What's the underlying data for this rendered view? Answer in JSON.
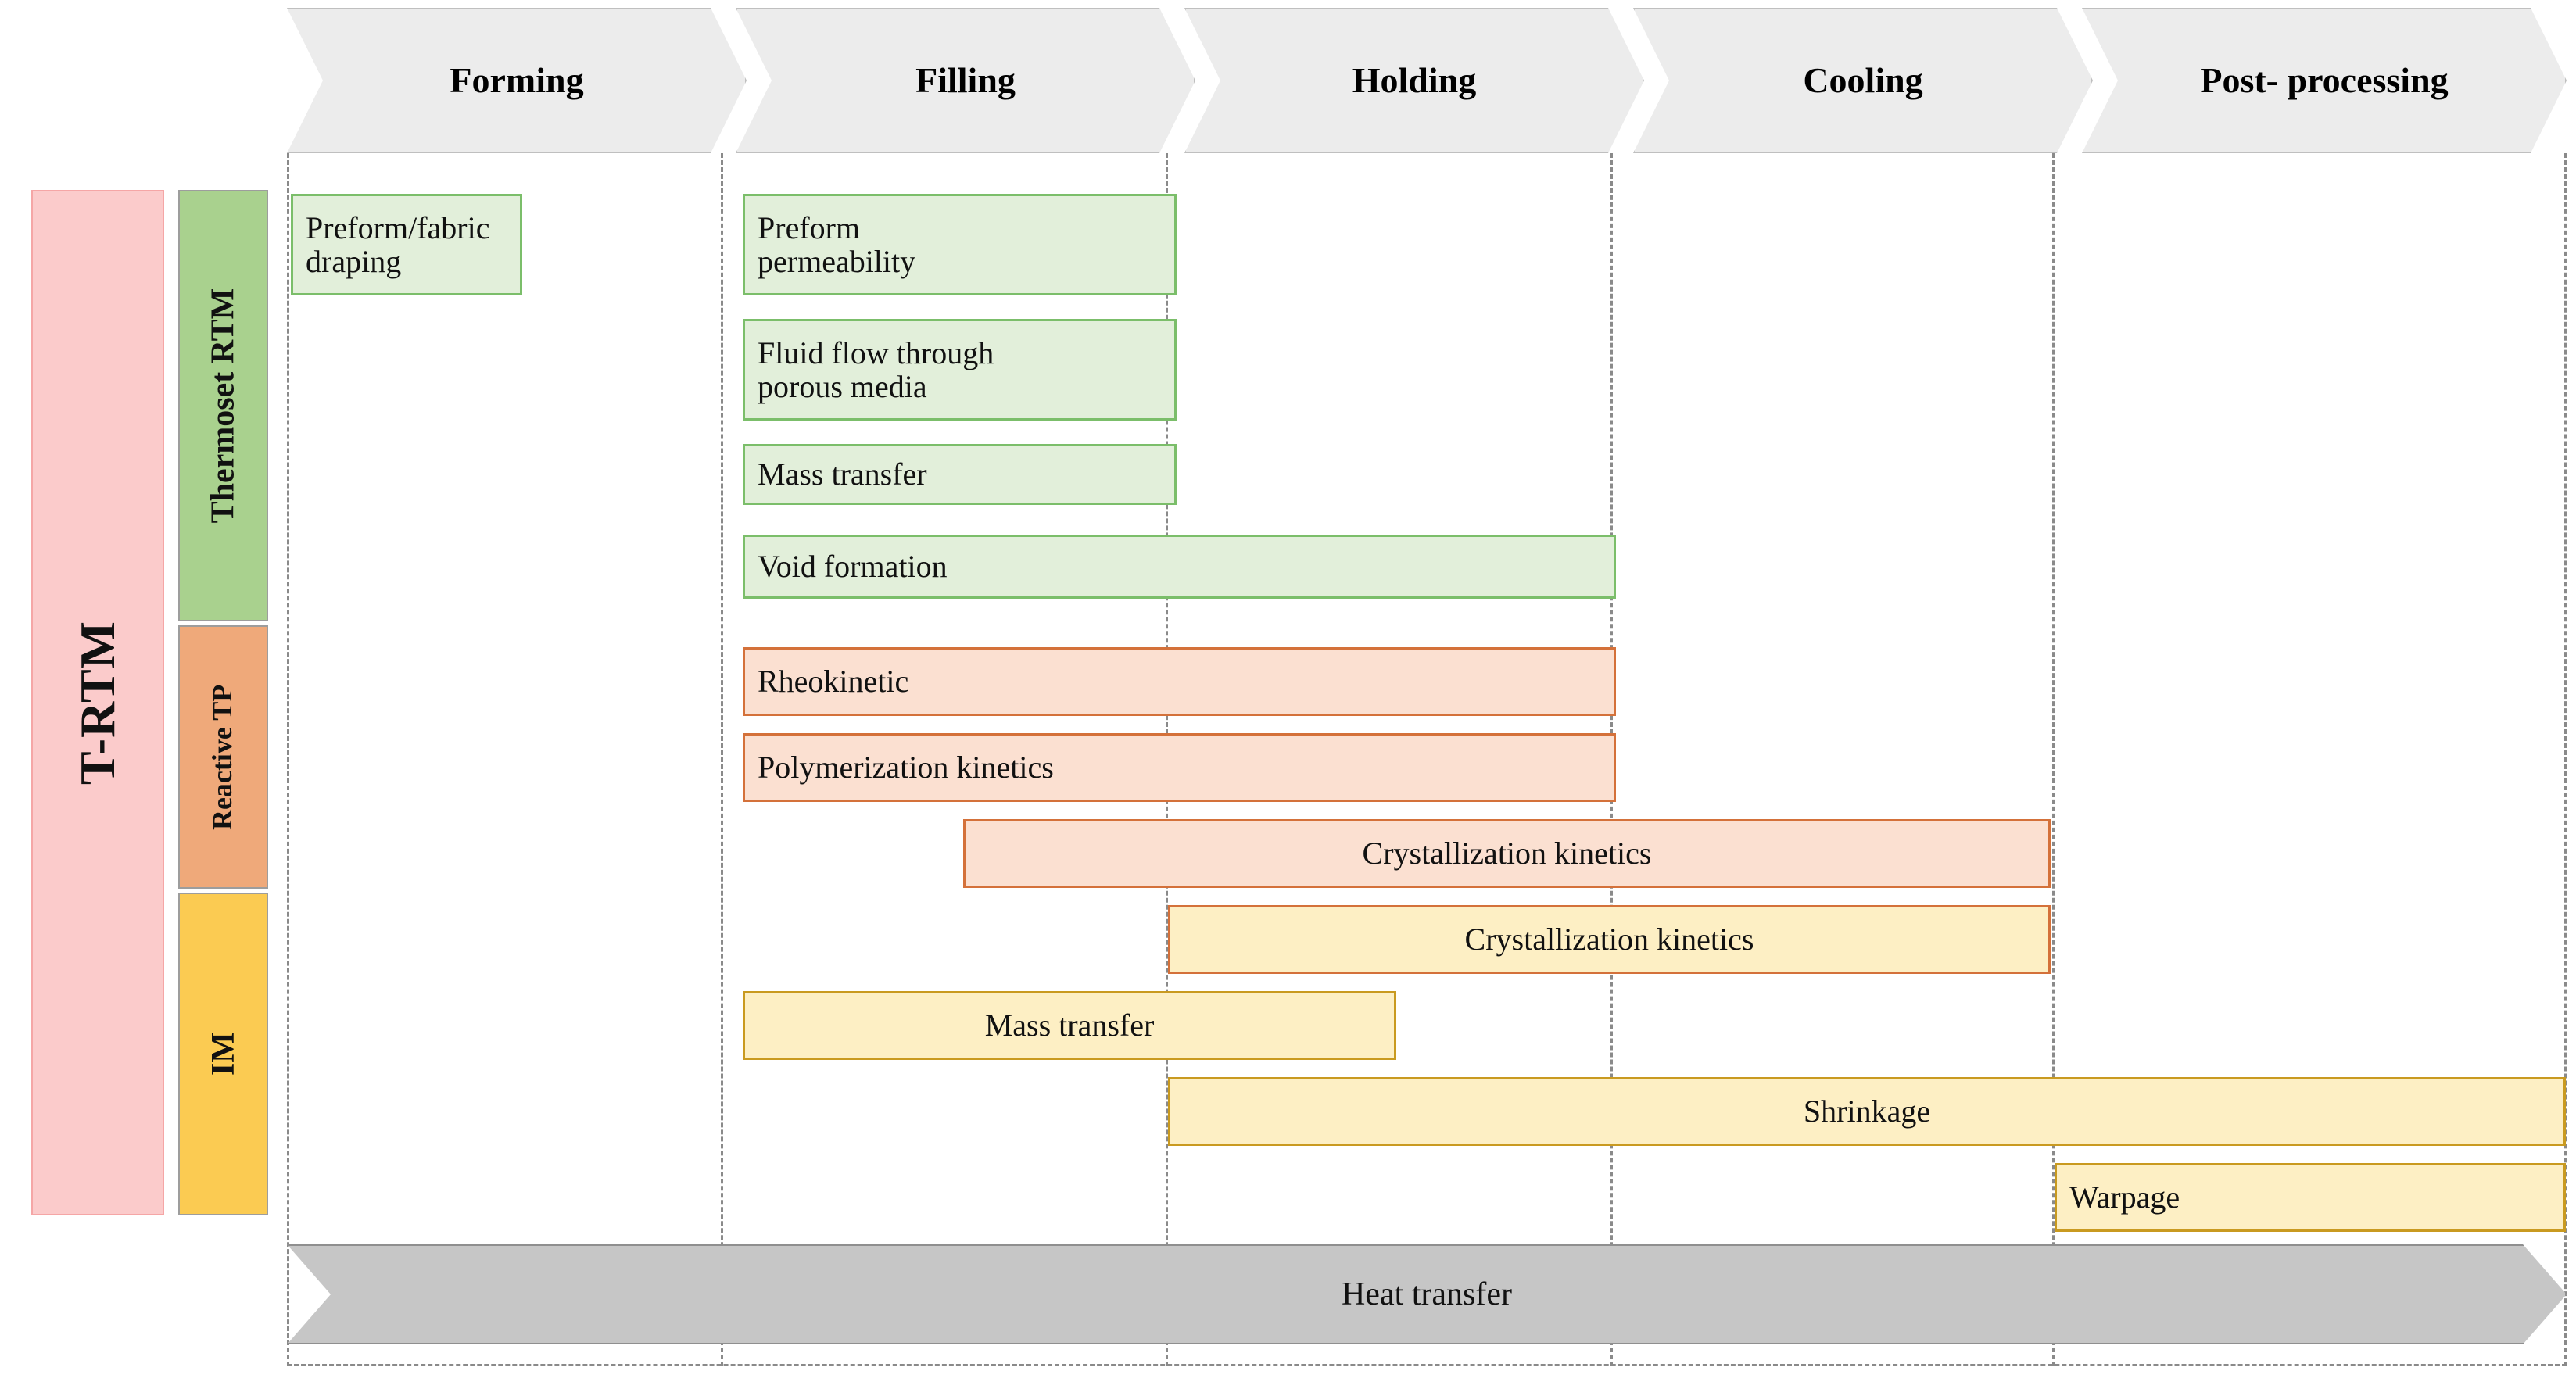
{
  "diagram": {
    "process_label": "T-RTM",
    "phases": [
      {
        "label": "Forming"
      },
      {
        "label": "Filling"
      },
      {
        "label": "Holding"
      },
      {
        "label": "Cooling"
      },
      {
        "label": "Post-\nprocessing"
      }
    ],
    "categories": [
      {
        "id": "thermoset-rtm",
        "label": "Thermoset RTM",
        "color": "#A9D18E"
      },
      {
        "id": "reactive-tp",
        "label": "Reactive\nTP",
        "color": "#EFA97A"
      },
      {
        "id": "im",
        "label": "IM",
        "color": "#FBCB52"
      }
    ],
    "colors": {
      "process_fill": "#FBCBCB",
      "process_border": "#F5A6A6",
      "green_fill": "#E2EFDA",
      "green_border": "#7BBE6A",
      "orange_fill": "#FBE0D1",
      "orange_border": "#D4713A",
      "yellow_fill": "#FDEFC4",
      "yellow_border": "#C99A20",
      "header_fill": "#ECECEC",
      "header_border": "#BFBFBF",
      "heat_fill": "#C6C6C6",
      "heat_border": "#8F8F8F"
    },
    "bars": [
      {
        "id": "preform-fabric-draping",
        "label": "Preform/fabric\ndraping",
        "category": "thermoset-rtm",
        "style": "green",
        "align": "left",
        "start_phase": "Forming",
        "end_phase": "Forming"
      },
      {
        "id": "preform-permeability",
        "label": "Preform\npermeability",
        "category": "thermoset-rtm",
        "style": "green",
        "align": "left",
        "start_phase": "Filling",
        "end_phase": "Filling"
      },
      {
        "id": "fluid-flow-porous-media",
        "label": "Fluid flow through\nporous media",
        "category": "thermoset-rtm",
        "style": "green",
        "align": "left",
        "start_phase": "Filling",
        "end_phase": "Filling"
      },
      {
        "id": "mass-transfer-rtm",
        "label": "Mass transfer",
        "category": "thermoset-rtm",
        "style": "green",
        "align": "left",
        "start_phase": "Filling",
        "end_phase": "Filling"
      },
      {
        "id": "void-formation",
        "label": "Void formation",
        "category": "thermoset-rtm",
        "style": "green",
        "align": "left",
        "start_phase": "Filling",
        "end_phase": "Holding"
      },
      {
        "id": "rheokinetic",
        "label": "Rheokinetic",
        "category": "reactive-tp",
        "style": "orange",
        "align": "left",
        "start_phase": "Filling",
        "end_phase": "Holding"
      },
      {
        "id": "polymerization-kinetics",
        "label": "Polymerization kinetics",
        "category": "reactive-tp",
        "style": "orange",
        "align": "left",
        "start_phase": "Filling",
        "end_phase": "Holding"
      },
      {
        "id": "crystallization-kinetics-tp",
        "label": "Crystallization kinetics",
        "category": "reactive-tp",
        "style": "orange",
        "align": "center",
        "start_phase": "Filling",
        "end_phase": "Cooling"
      },
      {
        "id": "crystallization-kinetics-im",
        "label": "Crystallization kinetics",
        "category": "im",
        "style": "yellow-orange",
        "align": "center",
        "start_phase": "Holding",
        "end_phase": "Cooling"
      },
      {
        "id": "mass-transfer-im",
        "label": "Mass transfer",
        "category": "im",
        "style": "yellow",
        "align": "center",
        "start_phase": "Filling",
        "end_phase": "Holding"
      },
      {
        "id": "shrinkage",
        "label": "Shrinkage",
        "category": "im",
        "style": "yellow",
        "align": "center",
        "start_phase": "Holding",
        "end_phase": "Post-processing"
      },
      {
        "id": "warpage",
        "label": "Warpage",
        "category": "im",
        "style": "yellow",
        "align": "left",
        "start_phase": "Post-processing",
        "end_phase": "Post-processing"
      }
    ],
    "global_bar": {
      "id": "heat-transfer",
      "label": "Heat transfer"
    }
  }
}
